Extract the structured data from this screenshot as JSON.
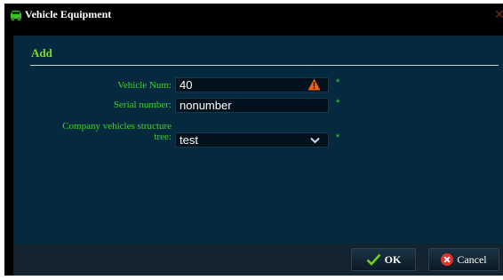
{
  "window": {
    "title": "Vehicle Equipment",
    "icon": "vehicle-icon",
    "close_icon": "close-icon"
  },
  "form": {
    "section_title": "Add",
    "fields": [
      {
        "label": "Vehicle Num:",
        "value": "40",
        "required_mark": "*",
        "status_icon": "warning-icon"
      },
      {
        "label": "Serial number:",
        "value": "nonumber",
        "required_mark": "*"
      },
      {
        "label": "Company vehicles structure tree:",
        "value": "test",
        "required_mark": "*",
        "control": "select",
        "options": [
          "test"
        ]
      }
    ]
  },
  "buttons": {
    "ok_label": "OK",
    "cancel_label": "Cancel"
  },
  "colors": {
    "background": "#000000",
    "panel": "#052a40",
    "label_green": "#3fd324",
    "title_green": "#7ddb2b",
    "warning_orange": "#e8641e",
    "cancel_red": "#e0322c",
    "ok_green": "#6fd11c"
  }
}
